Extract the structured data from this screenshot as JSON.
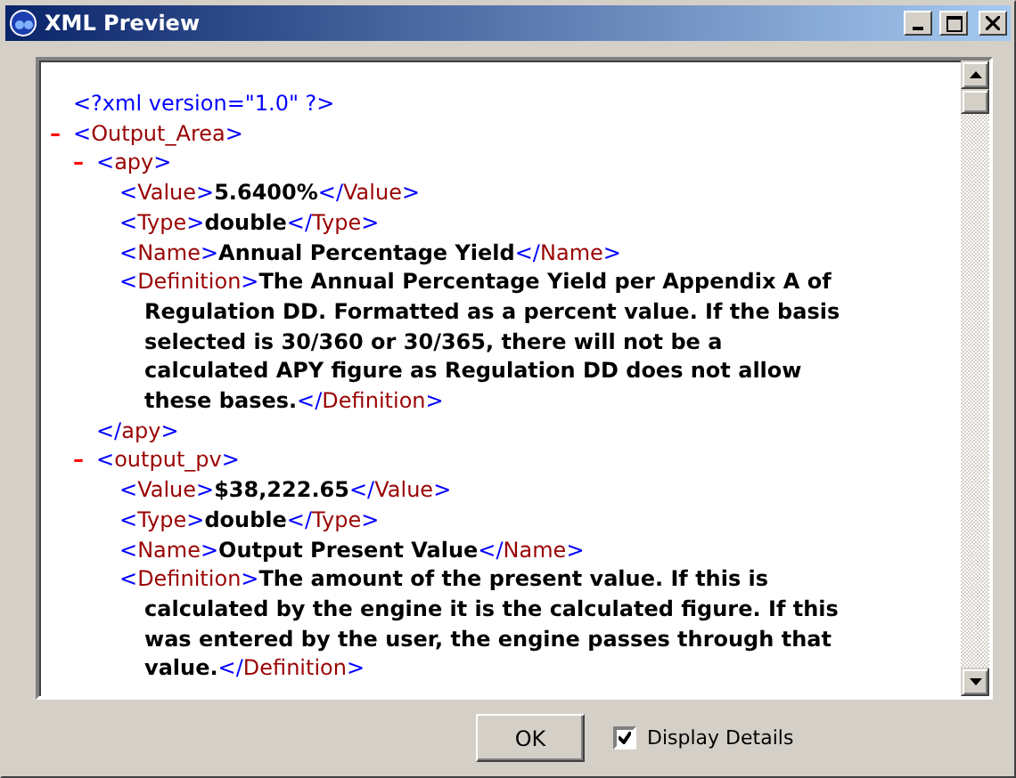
{
  "window": {
    "title": "XML Preview"
  },
  "xml": {
    "declaration": "<?xml version=\"1.0\" ?>",
    "root": {
      "kind": "element",
      "toggle": "–",
      "expanded": true,
      "open_tag": "<Output_Area>",
      "children": [
        {
          "kind": "element",
          "toggle": "–",
          "expanded": true,
          "open_tag": "<apy>",
          "close_tag": "</apy>",
          "children": [
            {
              "kind": "leaf",
              "open_tag": "<Value>",
              "text": "5.6400%",
              "close_tag": "</Value>"
            },
            {
              "kind": "leaf",
              "open_tag": "<Type>",
              "text": "double",
              "close_tag": "</Type>"
            },
            {
              "kind": "leaf",
              "open_tag": "<Name>",
              "text": "Annual Percentage Yield",
              "close_tag": "</Name>"
            },
            {
              "kind": "leaf",
              "open_tag": "<Definition>",
              "text": "The Annual Percentage Yield per Appendix A of Regulation DD. Formatted as a percent value. If the basis selected is 30/360 or 30/365, there will not be a calculated APY figure as Regulation DD does not allow these bases.",
              "close_tag": "</Definition>"
            }
          ]
        },
        {
          "kind": "element",
          "toggle": "–",
          "expanded": true,
          "open_tag": "<output_pv>",
          "children": [
            {
              "kind": "leaf",
              "open_tag": "<Value>",
              "text": "$38,222.65",
              "close_tag": "</Value>"
            },
            {
              "kind": "leaf",
              "open_tag": "<Type>",
              "text": "double",
              "close_tag": "</Type>"
            },
            {
              "kind": "leaf",
              "open_tag": "<Name>",
              "text": "Output Present Value",
              "close_tag": "</Name>"
            },
            {
              "kind": "leaf",
              "open_tag": "<Definition>",
              "text": "The amount of the present value. If this is calculated by the engine it is the calculated figure. If this was entered by the user, the engine passes through that value.",
              "close_tag": "</Definition>"
            }
          ]
        }
      ]
    }
  },
  "footer": {
    "ok_button": "OK",
    "display_details": {
      "label": "Display Details",
      "checked": true
    }
  }
}
